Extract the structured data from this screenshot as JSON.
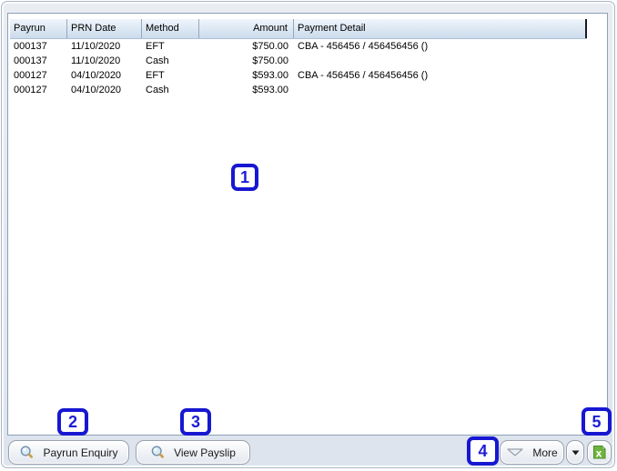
{
  "table": {
    "columns": [
      {
        "label": "Payrun"
      },
      {
        "label": "PRN Date"
      },
      {
        "label": "Method"
      },
      {
        "label": "Amount"
      },
      {
        "label": "Payment Detail"
      }
    ],
    "rows": [
      [
        "000137",
        "11/10/2020",
        "EFT",
        "$750.00",
        "CBA - 456456 / 456456456 ()"
      ],
      [
        "000137",
        "11/10/2020",
        "Cash",
        "$750.00",
        ""
      ],
      [
        "000127",
        "04/10/2020",
        "EFT",
        "$593.00",
        "CBA - 456456 / 456456456 ()"
      ],
      [
        "000127",
        "04/10/2020",
        "Cash",
        "$593.00",
        ""
      ]
    ]
  },
  "toolbar": {
    "payrun_enquiry_label": "Payrun Enquiry",
    "view_payslip_label": "View Payslip",
    "more_label": "More",
    "icons": {
      "payrun_enquiry": "magnifier-icon",
      "view_payslip": "magnifier-icon",
      "more": "filter-triangle-icon",
      "more_dropdown": "dropdown-arrow-icon",
      "export": "excel-export-icon"
    }
  },
  "annotations": {
    "badges": [
      "1",
      "2",
      "3",
      "4",
      "5"
    ],
    "badge_color": "#1717d2"
  },
  "colors": {
    "header_gradient_top": "#eff5fb",
    "header_gradient_bottom": "#cbdbec",
    "panel_border": "#8ba0b6",
    "window_background": "#e3e9f1",
    "excel_green": "#6fb53c"
  }
}
